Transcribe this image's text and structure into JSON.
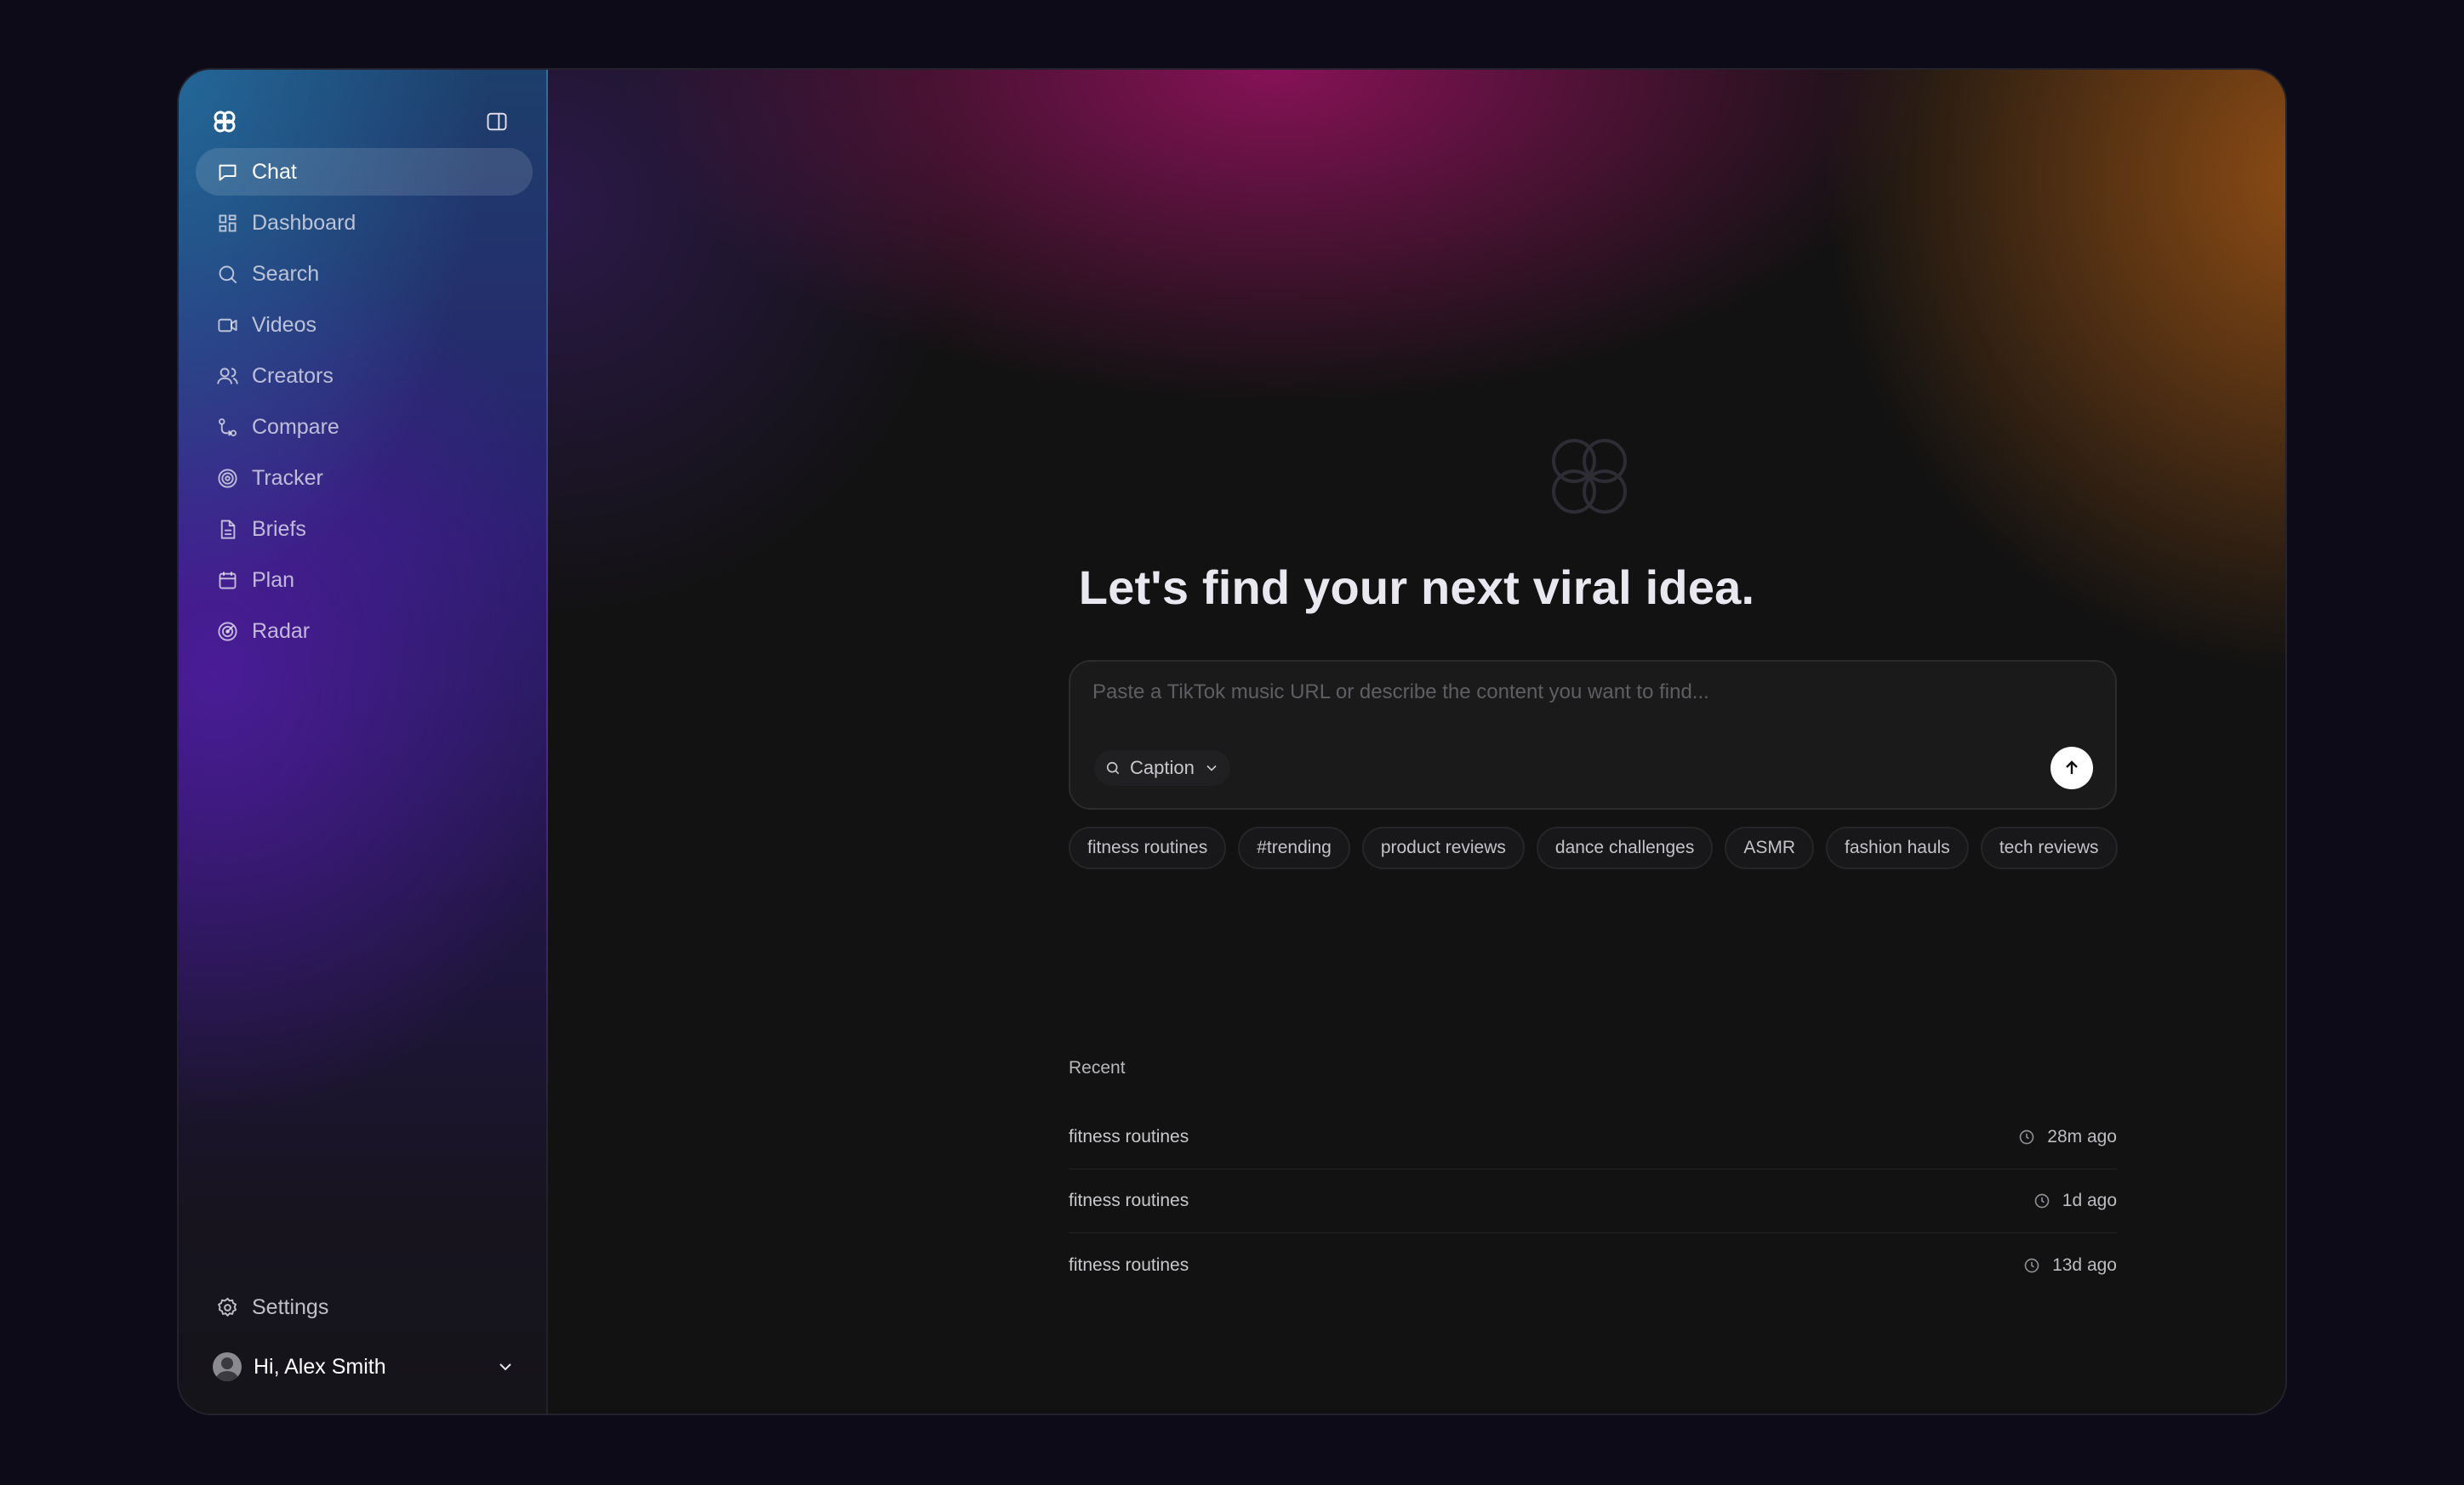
{
  "sidebar": {
    "logo_icon": "brand-knot-icon",
    "toggle_icon": "sidebar-toggle-icon",
    "items": [
      {
        "label": "Chat",
        "icon": "chat-bubble-icon",
        "active": true
      },
      {
        "label": "Dashboard",
        "icon": "dashboard-grid-icon"
      },
      {
        "label": "Search",
        "icon": "search-icon"
      },
      {
        "label": "Videos",
        "icon": "video-camera-icon"
      },
      {
        "label": "Creators",
        "icon": "users-icon"
      },
      {
        "label": "Compare",
        "icon": "git-compare-icon"
      },
      {
        "label": "Tracker",
        "icon": "target-icon"
      },
      {
        "label": "Briefs",
        "icon": "document-icon"
      },
      {
        "label": "Plan",
        "icon": "calendar-icon"
      },
      {
        "label": "Radar",
        "icon": "radar-icon"
      }
    ],
    "settings_label": "Settings",
    "user_greeting": "Hi, Alex Smith"
  },
  "main": {
    "headline": "Let's find your next viral idea.",
    "composer": {
      "placeholder": "Paste a TikTok music URL or describe the content you want to find...",
      "mode_label": "Caption"
    },
    "suggestions": [
      "fitness routines",
      "#trending",
      "product reviews",
      "dance challenges",
      "ASMR",
      "fashion hauls",
      "tech reviews"
    ],
    "recent_title": "Recent",
    "recent": [
      {
        "query": "fitness routines",
        "time": "28m ago"
      },
      {
        "query": "fitness routines",
        "time": "1d ago"
      },
      {
        "query": "fitness routines",
        "time": "13d ago"
      }
    ]
  },
  "colors": {
    "background": "#0e0b18",
    "panel": "#121212",
    "accent_magenta": "#8c125a",
    "accent_orange": "#965014",
    "accent_blue": "#246ea0"
  }
}
